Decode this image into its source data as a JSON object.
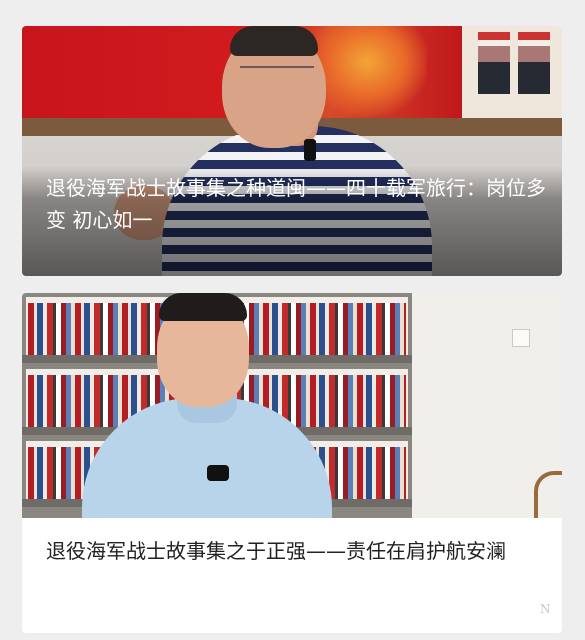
{
  "feed": {
    "articles": [
      {
        "title": "退役海军战士故事集之种道闽——四十载军旅行：岗位多变 初心如一",
        "image_alt": "interview-photo-man-in-striped-shirt"
      },
      {
        "title": "退役海军战士故事集之于正强——责任在肩护航安澜",
        "image_alt": "interview-photo-man-in-blue-shirt-with-bookshelf"
      }
    ],
    "watermark": "N"
  },
  "colors": {
    "background": "#eeeeee",
    "card": "#ffffff",
    "title_on_image": "#ffffff",
    "title_text": "#222222"
  }
}
